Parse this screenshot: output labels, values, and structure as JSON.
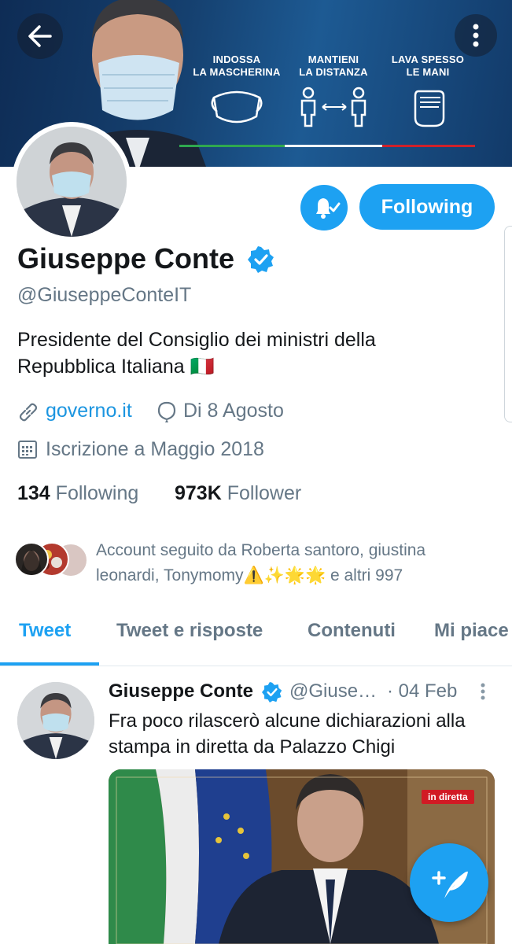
{
  "banner": {
    "messages": [
      "INDOSSA\nLA MASCHERINA",
      "MANTIENI\nLA DISTANZA",
      "LAVA SPESSO\nLE MANI"
    ]
  },
  "profile": {
    "name": "Giuseppe Conte",
    "handle": "@GiuseppeConteIT",
    "bio": "Presidente del Consiglio dei ministri della Repubblica Italiana 🇮🇹",
    "website": "governo.it",
    "birthday": "Di 8 Agosto",
    "joined": "Iscrizione a Maggio 2018",
    "following_count": "134",
    "following_label": "Following",
    "followers_count": "973K",
    "followers_label": "Follower",
    "follow_button": "Following",
    "followed_by": "Account seguito da Roberta santoro, giustina leonardi, Tonymomy⚠️✨🌟🌟 e altri 997"
  },
  "tabs": [
    "Tweet",
    "Tweet e risposte",
    "Contenuti",
    "Mi piace"
  ],
  "tweet": {
    "name": "Giuseppe Conte",
    "handle": "@Giuse…",
    "date": "· 04 Feb",
    "text": "Fra poco rilascerò alcune dichiarazioni alla stampa in diretta da Palazzo Chigi",
    "live_badge": "in diretta"
  },
  "colors": {
    "accent": "#1da1f2",
    "text": "#14171a",
    "muted": "#657786"
  },
  "icons": [
    "back-arrow-icon",
    "more-vertical-icon",
    "bell-check-icon",
    "verified-badge-icon",
    "link-icon",
    "balloon-icon",
    "calendar-icon",
    "compose-tweet-icon"
  ]
}
